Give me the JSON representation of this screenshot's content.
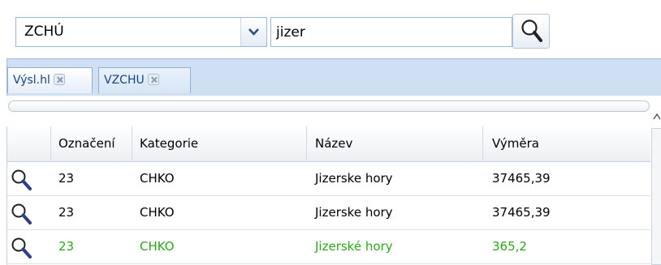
{
  "search": {
    "category_value": "ZCHÚ",
    "query_value": "jizer"
  },
  "icons": {
    "dropdown": "chevron-down-icon",
    "search": "magnifier-icon",
    "tab_close": "close-icon",
    "row_zoom": "magnifier-icon"
  },
  "tabs": [
    {
      "label": "Výsl.hl",
      "active": true
    },
    {
      "label": "VZCHU",
      "active": false
    }
  ],
  "table": {
    "columns": [
      "Označení",
      "Kategorie",
      "Název",
      "Výměra"
    ],
    "rows": [
      {
        "oznaceni": "23",
        "kategorie": "CHKO",
        "nazev": "Jizerske hory",
        "vymera": "37465,39",
        "highlight": false
      },
      {
        "oznaceni": "23",
        "kategorie": "CHKO",
        "nazev": "Jizerske hory",
        "vymera": "37465,39",
        "highlight": false
      },
      {
        "oznaceni": "23",
        "kategorie": "CHKO",
        "nazev": "Jizerské hory",
        "vymera": "365,2",
        "highlight": true
      }
    ]
  },
  "colors": {
    "highlight_text": "#2ea51d",
    "tab_text": "#15428b",
    "tabbar_bg": "#cfe0f3"
  }
}
